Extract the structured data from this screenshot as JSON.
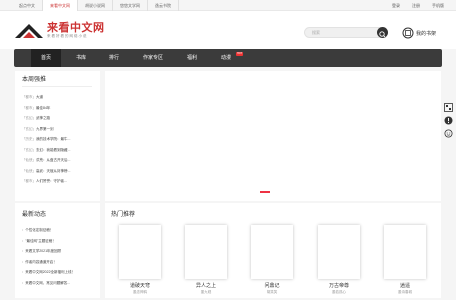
{
  "topbar": {
    "sites": [
      "起点中文",
      "来看中文网",
      "胡说小说网",
      "悠悠文学网",
      "逸云书院"
    ],
    "user": [
      "登录",
      "注册",
      "手机版"
    ]
  },
  "header": {
    "logo_main": "来看中文网",
    "logo_sub": "来看好看的网络小说",
    "search_placeholder": "搜索",
    "shelf_label": "我的书架"
  },
  "nav": {
    "items": [
      "首页",
      "书库",
      "排行",
      "作家专区",
      "福利",
      "动漫"
    ],
    "hot_badge": "HOT"
  },
  "weekly": {
    "title": "本周强推",
    "items": [
      {
        "tag": "「都市」",
        "name": "大道"
      },
      {
        "tag": "「都市」",
        "name": "最佳84年"
      },
      {
        "tag": "「玄幻」",
        "name": "武神之路"
      },
      {
        "tag": "「玄幻」",
        "name": "九界第一剑"
      },
      {
        "tag": "「历史」",
        "name": "我的技术学院：最牛..."
      },
      {
        "tag": "「玄幻」",
        "name": "玄幻：我能看到隐藏..."
      },
      {
        "tag": "「仙侠」",
        "name": "洪荒：从盘古开天后..."
      },
      {
        "tag": "「仙侠」",
        "name": "高武：天赋从封神榜..."
      },
      {
        "tag": "「都市」",
        "name": "人们赞誉：守护者..."
      }
    ]
  },
  "news": {
    "title": "最新动态",
    "items": [
      "个性化定制征稿！",
      "\"最佳网\"主题征稿！",
      "来看文学2021年度回顾",
      "作者内容通道开启！",
      "来看中文网2022全新福利上线！",
      "来看中文网，常见问题解答..."
    ]
  },
  "hot": {
    "title": "热门推荐",
    "books": [
      {
        "name": "道破天穹",
        "author": "墨念神鸦"
      },
      {
        "name": "异人之上",
        "author": "墨九砚"
      },
      {
        "name": "问鼎记",
        "author": "胡笑笑"
      },
      {
        "name": "万古帝尊",
        "author": "墨若孤心"
      },
      {
        "name": "逍遥",
        "author": "墨诗春城"
      }
    ]
  },
  "colors": {
    "brand": "#cc3333",
    "nav_bg": "#3b3b3b",
    "nav_active": "#222222"
  }
}
